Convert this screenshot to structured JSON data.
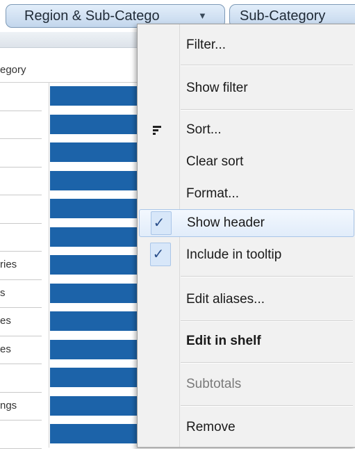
{
  "shelf": {
    "pill_region_label": "Region & Sub-Catego",
    "pill_subcategory_label": "Sub-Category",
    "caret_glyph": "▼"
  },
  "sheet": {
    "column_header": "egory",
    "row_labels": [
      "",
      "",
      "",
      "",
      "",
      "",
      "ries",
      "s",
      "es",
      "es",
      "",
      "ngs",
      ""
    ],
    "bar_color": "#1c63a9"
  },
  "menu": {
    "filter": "Filter...",
    "show_filter": "Show filter",
    "sort": "Sort...",
    "clear_sort": "Clear sort",
    "format": "Format...",
    "show_header": "Show header",
    "include_in_tooltip": "Include in tooltip",
    "edit_aliases": "Edit aliases...",
    "edit_in_shelf": "Edit in shelf",
    "subtotals": "Subtotals",
    "remove": "Remove",
    "check_glyph": "✓"
  }
}
